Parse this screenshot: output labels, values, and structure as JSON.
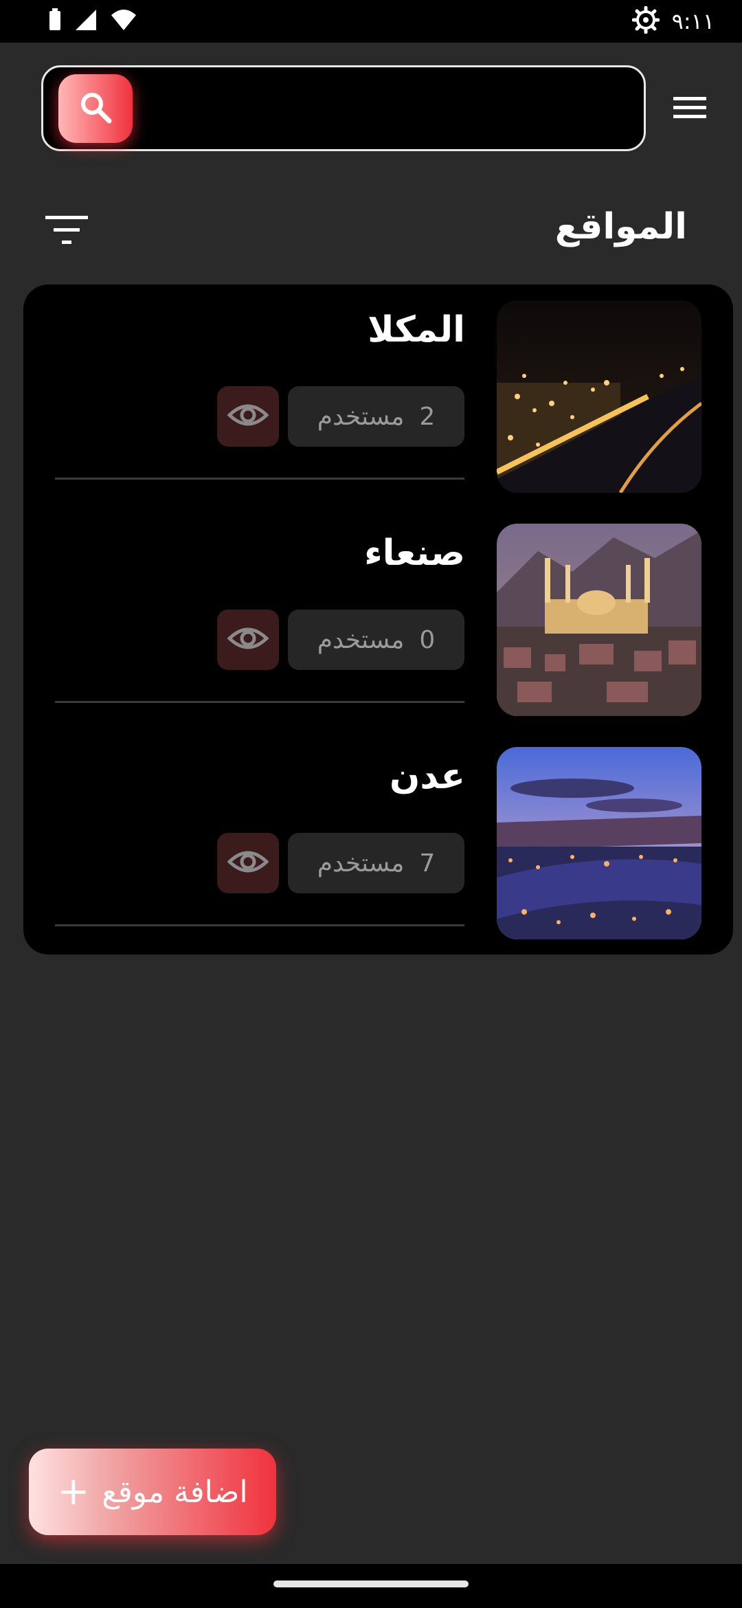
{
  "status_bar": {
    "time": "٩:١١",
    "icons": [
      "battery-icon",
      "signal-icon",
      "wifi-icon",
      "settings-icon"
    ]
  },
  "search": {
    "placeholder": "",
    "value": "",
    "button_icon": "search-icon"
  },
  "header": {
    "menu_icon": "hamburger-icon"
  },
  "section": {
    "title": "المواقع",
    "filter_icon": "filter-icon"
  },
  "locations": [
    {
      "name": "المكلا",
      "users_count": "2",
      "users_label": "مستخدم",
      "image": "city-night-coast"
    },
    {
      "name": "صنعاء",
      "users_count": "0",
      "users_label": "مستخدم",
      "image": "mosque-city"
    },
    {
      "name": "عدن",
      "users_count": "7",
      "users_label": "مستخدم",
      "image": "harbor-dusk"
    }
  ],
  "add_button": {
    "label": "اضافة موقع",
    "icon": "plus-icon"
  },
  "colors": {
    "background": "#2a2a2a",
    "surface": "#000000",
    "accent": "#f0323d",
    "accent_light": "#ffb7b7",
    "muted_text": "#9a9a9a"
  }
}
